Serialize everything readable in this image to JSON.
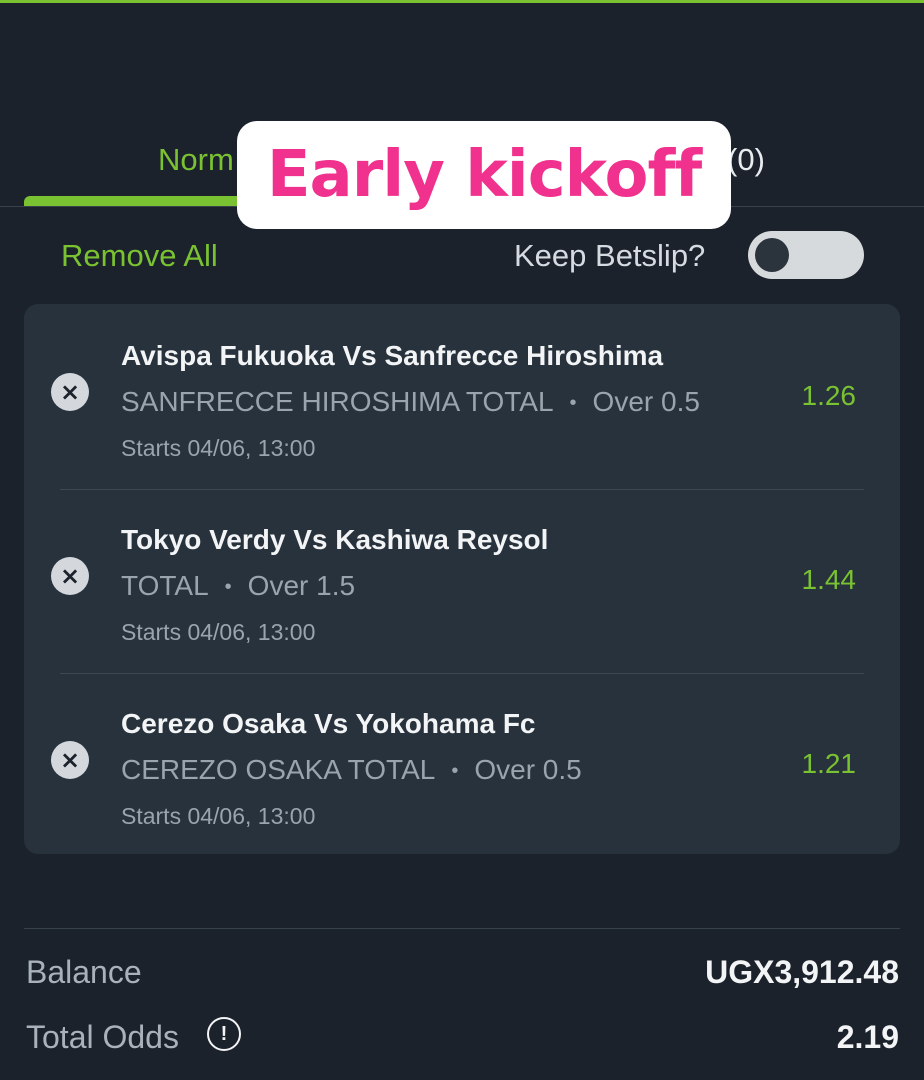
{
  "tabs": [
    {
      "label": "Norm",
      "active": true
    },
    {
      "label": "(0)",
      "active": false
    }
  ],
  "overlay": {
    "text": "Early kickoff"
  },
  "actions": {
    "remove_all": "Remove All",
    "keep_betslip": "Keep Betslip?",
    "keep_betslip_on": false
  },
  "bets": [
    {
      "match": "Avispa Fukuoka Vs Sanfrecce Hiroshima",
      "market": "SANFRECCE HIROSHIMA TOTAL",
      "selection": "Over 0.5",
      "starts": "Starts 04/06, 13:00",
      "odds": "1.26",
      "remove_icon": "×"
    },
    {
      "match": "Tokyo Verdy Vs Kashiwa Reysol",
      "market": "TOTAL",
      "selection": "Over 1.5",
      "starts": "Starts 04/06, 13:00",
      "odds": "1.44",
      "remove_icon": "×"
    },
    {
      "match": "Cerezo Osaka Vs Yokohama Fc",
      "market": "CEREZO OSAKA TOTAL",
      "selection": "Over 0.5",
      "starts": "Starts 04/06, 13:00",
      "odds": "1.21",
      "remove_icon": "×"
    }
  ],
  "summary": {
    "balance_label": "Balance",
    "balance_value": "UGX3,912.48",
    "total_odds_label": "Total Odds",
    "total_odds_value": "2.19",
    "info_icon": "!"
  },
  "colors": {
    "accent": "#7ac231",
    "background": "#1b222b",
    "card": "#28323c",
    "overlay_text": "#f0318d"
  }
}
